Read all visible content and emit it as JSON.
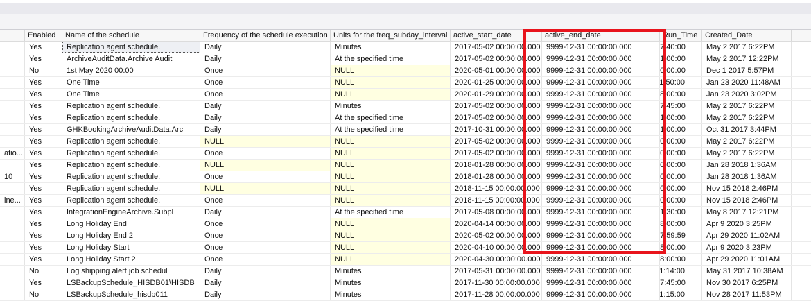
{
  "columns": [
    "",
    "Enabled",
    "Name of the schedule",
    "Frequency of the schedule execution",
    "Units for the freq_subday_interval",
    "active_start_date",
    "active_end_date",
    "Run_Time",
    "Created_Date"
  ],
  "rows": [
    [
      "",
      "Yes",
      "Replication agent schedule.",
      "Daily",
      "Minutes",
      "2017-05-02 00:00:00.000",
      "9999-12-31 00:00:00.000",
      "17:40:00",
      "May  2 2017  6:22PM"
    ],
    [
      "",
      "Yes",
      "ArchiveAuditData.Archive Audit",
      "Daily",
      "At the specified time",
      "2017-05-02 00:00:00.000",
      "9999-12-31 00:00:00.000",
      "01:00:00",
      "May  2 2017 12:22PM"
    ],
    [
      "",
      "No",
      "1st May 2020 00:00",
      "Once",
      "NULL",
      "2020-05-01 00:00:00.000",
      "9999-12-31 00:00:00.000",
      "00:00:00",
      "Dec  1 2017  5:57PM"
    ],
    [
      "",
      "Yes",
      "One Time",
      "Once",
      "NULL",
      "2020-01-25 00:00:00.000",
      "9999-12-31 00:00:00.000",
      "11:50:00",
      "Jan 23 2020 11:48AM"
    ],
    [
      "",
      "Yes",
      "One Time",
      "Once",
      "NULL",
      "2020-01-29 00:00:00.000",
      "9999-12-31 00:00:00.000",
      "08:00:00",
      "Jan 23 2020  3:02PM"
    ],
    [
      "",
      "Yes",
      "Replication agent schedule.",
      "Daily",
      "Minutes",
      "2017-05-02 00:00:00.000",
      "9999-12-31 00:00:00.000",
      "17:45:00",
      "May  2 2017  6:22PM"
    ],
    [
      "",
      "Yes",
      "Replication agent schedule.",
      "Daily",
      "At the specified time",
      "2017-05-02 00:00:00.000",
      "9999-12-31 00:00:00.000",
      "01:00:00",
      "May  2 2017  6:22PM"
    ],
    [
      "",
      "Yes",
      "GHKBookingArchiveAuditData.Arc",
      "Daily",
      "At the specified time",
      "2017-10-31 00:00:00.000",
      "9999-12-31 00:00:00.000",
      "01:00:00",
      "Oct 31 2017  3:44PM"
    ],
    [
      "",
      "Yes",
      "Replication agent schedule.",
      "NULL",
      "NULL",
      "2017-05-02 00:00:00.000",
      "9999-12-31 00:00:00.000",
      "00:00:00",
      "May  2 2017  6:22PM"
    ],
    [
      "atio...",
      "Yes",
      "Replication agent schedule.",
      "Once",
      "NULL",
      "2017-05-02 00:00:00.000",
      "9999-12-31 00:00:00.000",
      "00:00:00",
      "May  2 2017  6:22PM"
    ],
    [
      "",
      "Yes",
      "Replication agent schedule.",
      "NULL",
      "NULL",
      "2018-01-28 00:00:00.000",
      "9999-12-31 00:00:00.000",
      "00:00:00",
      "Jan 28 2018  1:36AM"
    ],
    [
      "10",
      "Yes",
      "Replication agent schedule.",
      "Once",
      "NULL",
      "2018-01-28 00:00:00.000",
      "9999-12-31 00:00:00.000",
      "00:00:00",
      "Jan 28 2018  1:36AM"
    ],
    [
      "",
      "Yes",
      "Replication agent schedule.",
      "NULL",
      "NULL",
      "2018-11-15 00:00:00.000",
      "9999-12-31 00:00:00.000",
      "00:00:00",
      "Nov 15 2018  2:46PM"
    ],
    [
      "ine...",
      "Yes",
      "Replication agent schedule.",
      "Once",
      "NULL",
      "2018-11-15 00:00:00.000",
      "9999-12-31 00:00:00.000",
      "00:00:00",
      "Nov 15 2018  2:46PM"
    ],
    [
      "",
      "Yes",
      "IntegrationEngineArchive.Subpl",
      "Daily",
      "At the specified time",
      "2017-05-08 00:00:00.000",
      "9999-12-31 00:00:00.000",
      "01:30:00",
      "May  8 2017 12:21PM"
    ],
    [
      "",
      "Yes",
      "Long Holiday End",
      "Once",
      "NULL",
      "2020-04-14 00:00:00.000",
      "9999-12-31 00:00:00.000",
      "08:00:00",
      "Apr  9 2020  3:25PM"
    ],
    [
      "",
      "Yes",
      "Long Holiday End 2",
      "Once",
      "NULL",
      "2020-05-02 00:00:00.000",
      "9999-12-31 00:00:00.000",
      "07:59:59",
      "Apr 29 2020 11:02AM"
    ],
    [
      "",
      "Yes",
      "Long Holiday Start",
      "Once",
      "NULL",
      "2020-04-10 00:00:00.000",
      "9999-12-31 00:00:00.000",
      "08:00:00",
      "Apr  9 2020  3:23PM"
    ],
    [
      "",
      "Yes",
      "Long Holiday Start 2",
      "Once",
      "NULL",
      "2020-04-30 00:00:00.000",
      "9999-12-31 00:00:00.000",
      "08:00:00",
      "Apr 29 2020 11:01AM"
    ],
    [
      "",
      "No",
      "Log shipping alert job schedul",
      "Daily",
      "Minutes",
      "2017-05-31 00:00:00.000",
      "9999-12-31 00:00:00.000",
      "11:14:00",
      "May 31 2017 10:38AM"
    ],
    [
      "",
      "Yes",
      "LSBackupSchedule_HISDB01\\HISDB",
      "Daily",
      "Minutes",
      "2017-11-30 00:00:00.000",
      "9999-12-31 00:00:00.000",
      "17:45:00",
      "Nov 30 2017  6:25PM"
    ],
    [
      "",
      "No",
      "LSBackupSchedule_hisdb011",
      "Daily",
      "Minutes",
      "2017-11-28 00:00:00.000",
      "9999-12-31 00:00:00.000",
      "11:15:00",
      "Nov 28 2017 11:53PM"
    ]
  ],
  "highlight": {
    "column": "active_end_date",
    "color": "#e8141c"
  },
  "null_cell_color": "#ffffe1"
}
